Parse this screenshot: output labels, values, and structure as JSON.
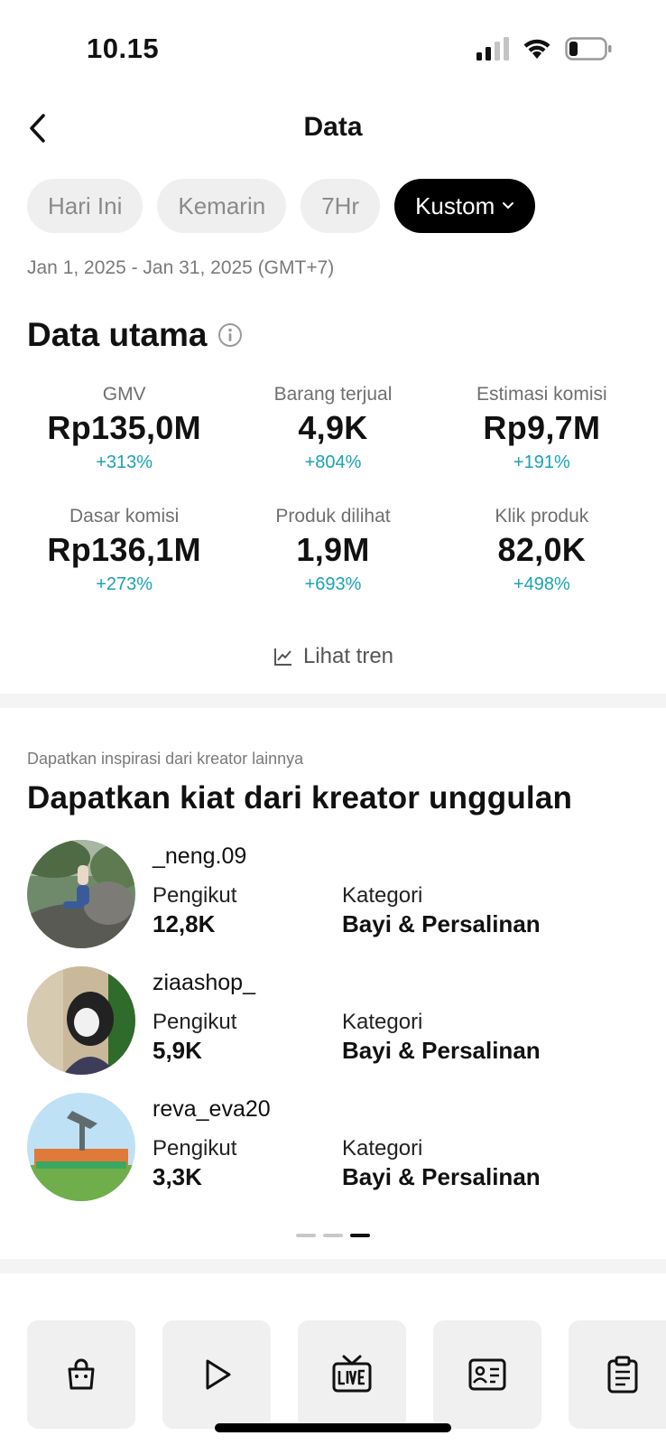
{
  "status_bar": {
    "time": "10.15"
  },
  "nav": {
    "title": "Data"
  },
  "filters": [
    {
      "label": "Hari Ini",
      "active": false
    },
    {
      "label": "Kemarin",
      "active": false
    },
    {
      "label": "7Hr",
      "active": false
    },
    {
      "label": "Kustom",
      "active": true
    }
  ],
  "date_range": "Jan 1, 2025 - Jan 31, 2025 (GMT+7)",
  "main": {
    "title": "Data utama",
    "metrics": [
      {
        "label": "GMV",
        "value": "Rp135,0M",
        "delta": "+313%"
      },
      {
        "label": "Barang terjual",
        "value": "4,9K",
        "delta": "+804%"
      },
      {
        "label": "Estimasi komisi",
        "value": "Rp9,7M",
        "delta": "+191%"
      },
      {
        "label": "Dasar komisi",
        "value": "Rp136,1M",
        "delta": "+273%"
      },
      {
        "label": "Produk dilihat",
        "value": "1,9M",
        "delta": "+693%"
      },
      {
        "label": "Klik produk",
        "value": "82,0K",
        "delta": "+498%"
      }
    ],
    "trend_label": "Lihat tren"
  },
  "inspiration": {
    "subtitle": "Dapatkan inspirasi dari kreator lainnya",
    "title": "Dapatkan kiat dari kreator unggulan",
    "creators": [
      {
        "name": "_neng.09",
        "followers_label": "Pengikut",
        "followers": "12,8K",
        "category_label": "Kategori",
        "category": "Bayi & Persalinan"
      },
      {
        "name": "ziaashop_",
        "followers_label": "Pengikut",
        "followers": "5,9K",
        "category_label": "Kategori",
        "category": "Bayi & Persalinan"
      },
      {
        "name": "reva_eva20",
        "followers_label": "Pengikut",
        "followers": "3,3K",
        "category_label": "Kategori",
        "category": "Bayi & Persalinan"
      }
    ],
    "pager": {
      "pages": 3,
      "active": 3
    }
  },
  "colors": {
    "accent_delta": "#1aa3b3",
    "active_chip": "#000000",
    "chip_bg": "#efefef"
  },
  "tools": [
    "shopping-bag-icon",
    "play-icon",
    "live-icon",
    "id-card-icon",
    "clipboard-icon"
  ]
}
